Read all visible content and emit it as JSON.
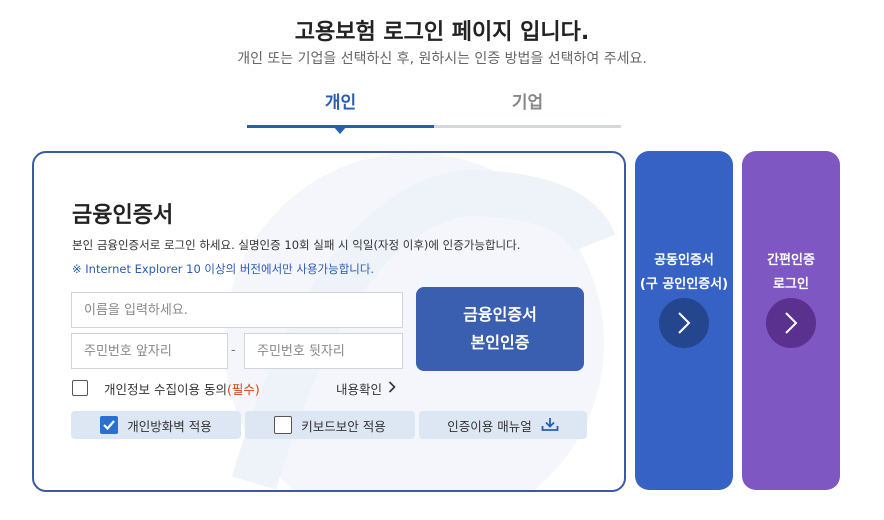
{
  "header": {
    "title": "고용보험 로그인 페이지 입니다.",
    "subtitle": "개인 또는 기업을 선택하신 후, 원하시는 인증 방법을 선택하여 주세요."
  },
  "tabs": [
    {
      "label": "개인",
      "active": true
    },
    {
      "label": "기업",
      "active": false
    }
  ],
  "card": {
    "title": "금융인증서",
    "description": "본인 금융인증서로 로그인 하세요. 실명인증 10회 실패 시 익일(자정 이후)에 인증가능합니다.",
    "note": "※ Internet Explorer 10 이상의 버전에서만 사용가능합니다.",
    "name_placeholder": "이름을 입력하세요.",
    "rrn_front_placeholder": "주민번호 앞자리",
    "rrn_dash": "-",
    "rrn_back_placeholder": "주민번호 뒷자리",
    "submit_line1": "금융인증서",
    "submit_line2": "본인인증",
    "agree_label": "개인정보 수집이용 동의",
    "agree_required": "(필수)",
    "view_label": "내용확인",
    "options": {
      "firewall": {
        "label": "개인방화벽 적용",
        "checked": true
      },
      "keyboard": {
        "label": "키보드보안 적용",
        "checked": false
      },
      "manual": {
        "label": "인증이용 매뉴얼",
        "icon": "download-icon"
      }
    }
  },
  "side_buttons": [
    {
      "line1": "공동인증서",
      "line2": "(구 공인인증서)",
      "color": "#3562c4"
    },
    {
      "line1": "간편인증",
      "line2": "로그인",
      "color": "#7e57c2"
    }
  ],
  "colors": {
    "accent": "#2a5bb5",
    "required": "#d2431a",
    "option_bg": "#dde6f3"
  }
}
